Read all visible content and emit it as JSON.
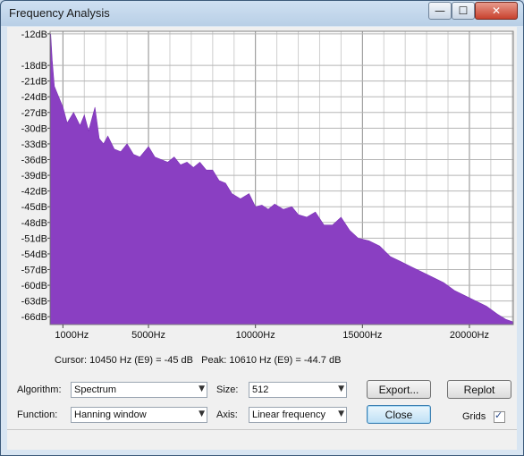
{
  "window": {
    "title": "Frequency Analysis",
    "controls": {
      "minimize": "—",
      "maximize": "☐",
      "close": "✕"
    }
  },
  "chart_data": {
    "type": "area",
    "title": "",
    "xlabel": "",
    "ylabel": "",
    "xlim": [
      400,
      22050
    ],
    "ylim": [
      -67.5,
      -11.5
    ],
    "x_ticks": [
      {
        "value": 1000,
        "label": "1000Hz"
      },
      {
        "value": 5000,
        "label": "5000Hz"
      },
      {
        "value": 10000,
        "label": "10000Hz"
      },
      {
        "value": 15000,
        "label": "15000Hz"
      },
      {
        "value": 20000,
        "label": "20000Hz"
      }
    ],
    "y_ticks": [
      {
        "value": -12,
        "label": "-12dB"
      },
      {
        "value": -18,
        "label": "-18dB"
      },
      {
        "value": -21,
        "label": "-21dB"
      },
      {
        "value": -24,
        "label": "-24dB"
      },
      {
        "value": -27,
        "label": "-27dB"
      },
      {
        "value": -30,
        "label": "-30dB"
      },
      {
        "value": -33,
        "label": "-33dB"
      },
      {
        "value": -36,
        "label": "-36dB"
      },
      {
        "value": -39,
        "label": "-39dB"
      },
      {
        "value": -42,
        "label": "-42dB"
      },
      {
        "value": -45,
        "label": "-45dB"
      },
      {
        "value": -48,
        "label": "-48dB"
      },
      {
        "value": -51,
        "label": "-51dB"
      },
      {
        "value": -54,
        "label": "-54dB"
      },
      {
        "value": -57,
        "label": "-57dB"
      },
      {
        "value": -60,
        "label": "-60dB"
      },
      {
        "value": -63,
        "label": "-63dB"
      },
      {
        "value": -66,
        "label": "-66dB"
      }
    ],
    "grid": true,
    "color": "#8a3fc2",
    "series": [
      {
        "x": [
          430,
          500,
          600,
          800,
          1000,
          1200,
          1500,
          1800,
          2000,
          2200,
          2500,
          2700,
          2900,
          3100,
          3400,
          3700,
          4000,
          4300,
          4600,
          5000,
          5300,
          5600,
          5900,
          6200,
          6500,
          6800,
          7100,
          7400,
          7700,
          8000,
          8300,
          8600,
          8900,
          9300,
          9700,
          10000,
          10300,
          10600,
          10900,
          11300,
          11700,
          12000,
          12400,
          12800,
          13200,
          13600,
          14000,
          14400,
          14800,
          15300,
          15800,
          16300,
          16800,
          17300,
          17800,
          18300,
          18800,
          19300,
          19800,
          20300,
          20800,
          21300,
          21700,
          22050
        ],
        "y": [
          -12,
          -17,
          -22,
          -24,
          -26,
          -29,
          -27,
          -29.5,
          -27.5,
          -30.5,
          -26,
          -32,
          -33,
          -31.5,
          -34,
          -34.5,
          -33,
          -35,
          -35.5,
          -33.5,
          -35.5,
          -36,
          -36.5,
          -35.5,
          -37,
          -36.5,
          -37.5,
          -36.5,
          -38,
          -38,
          -40,
          -40.5,
          -42.5,
          -43.5,
          -42.5,
          -45,
          -44.7,
          -45.5,
          -44.5,
          -45.5,
          -45,
          -46.5,
          -47,
          -46,
          -48.5,
          -48.5,
          -47,
          -49.5,
          -51,
          -51.5,
          -52.5,
          -54.5,
          -55.5,
          -56.5,
          -57.5,
          -58.5,
          -59.5,
          -61,
          -62,
          -63,
          -64,
          -65.5,
          -66.5,
          -67
        ]
      }
    ]
  },
  "status": {
    "cursor": "Cursor: 10450 Hz (E9) = -45 dB",
    "peak": "Peak: 10610 Hz (E9) = -44.7 dB"
  },
  "controls": {
    "algorithm_label": "Algorithm:",
    "algorithm_value": "Spectrum",
    "size_label": "Size:",
    "size_value": "512",
    "export_button": "Export...",
    "replot_button": "Replot",
    "function_label": "Function:",
    "function_value": "Hanning window",
    "axis_label": "Axis:",
    "axis_value": "Linear frequency",
    "close_button": "Close",
    "grids_label": "Grids",
    "grids_checked": true
  },
  "icons": {
    "dropdown": "chevron-down-icon",
    "check": "checkmark-icon"
  }
}
